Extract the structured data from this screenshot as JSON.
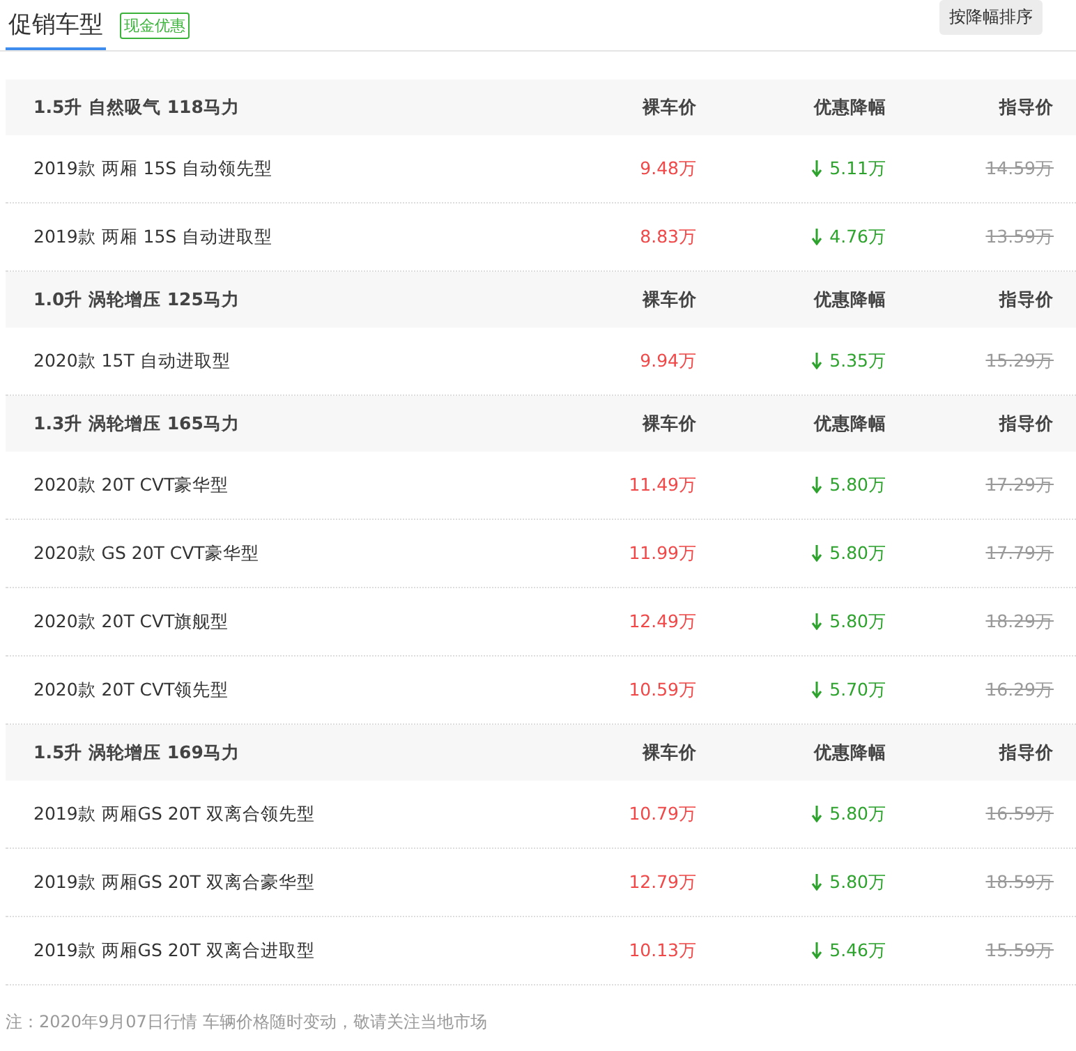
{
  "header": {
    "tab": {
      "label": "促销车型",
      "selected": true
    },
    "badge": "现金优惠",
    "sort_button": "按降幅排序"
  },
  "groups": [
    {
      "title": "1.5升 自然吸气 118马力",
      "columns": [
        "裸车价",
        "优惠降幅",
        "指导价"
      ],
      "rows": [
        {
          "name": "2019款 两厢 15S 自动领先型",
          "price": "9.48万",
          "drop": "5.11万",
          "guide": "14.59万"
        },
        {
          "name": "2019款 两厢 15S 自动进取型",
          "price": "8.83万",
          "drop": "4.76万",
          "guide": "13.59万"
        }
      ]
    },
    {
      "title": "1.0升 涡轮增压 125马力",
      "columns": [
        "裸车价",
        "优惠降幅",
        "指导价"
      ],
      "rows": [
        {
          "name": "2020款 15T 自动进取型",
          "price": "9.94万",
          "drop": "5.35万",
          "guide": "15.29万"
        }
      ]
    },
    {
      "title": "1.3升 涡轮增压 165马力",
      "columns": [
        "裸车价",
        "优惠降幅",
        "指导价"
      ],
      "rows": [
        {
          "name": "2020款 20T CVT豪华型",
          "price": "11.49万",
          "drop": "5.80万",
          "guide": "17.29万"
        },
        {
          "name": "2020款 GS 20T CVT豪华型",
          "price": "11.99万",
          "drop": "5.80万",
          "guide": "17.79万"
        },
        {
          "name": "2020款 20T CVT旗舰型",
          "price": "12.49万",
          "drop": "5.80万",
          "guide": "18.29万"
        },
        {
          "name": "2020款 20T CVT领先型",
          "price": "10.59万",
          "drop": "5.70万",
          "guide": "16.29万"
        }
      ]
    },
    {
      "title": "1.5升 涡轮增压 169马力",
      "columns": [
        "裸车价",
        "优惠降幅",
        "指导价"
      ],
      "rows": [
        {
          "name": "2019款 两厢GS 20T 双离合领先型",
          "price": "10.79万",
          "drop": "5.80万",
          "guide": "16.59万"
        },
        {
          "name": "2019款 两厢GS 20T 双离合豪华型",
          "price": "12.79万",
          "drop": "5.80万",
          "guide": "18.59万"
        },
        {
          "name": "2019款 两厢GS 20T 双离合进取型",
          "price": "10.13万",
          "drop": "5.46万",
          "guide": "15.59万"
        }
      ]
    }
  ],
  "note": "注：2020年9月07日行情 车辆价格随时变动，敬请关注当地市场"
}
